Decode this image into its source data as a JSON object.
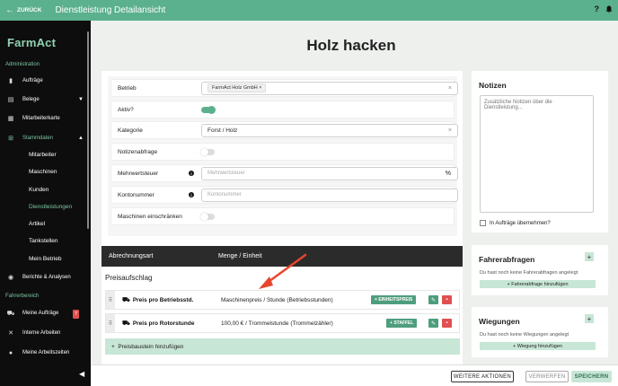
{
  "topbar": {
    "back_label": "ZURÜCK",
    "title": "Dienstleistung Detailansicht",
    "help_icon": "?",
    "icons": [
      "help-icon",
      "bell-icon"
    ]
  },
  "sidebar": {
    "logo": "FarmAct",
    "sections": {
      "admin": "Administration",
      "driver": "Fahrerbereich"
    },
    "items": [
      {
        "label": "Aufträge",
        "icon": "clipboard-icon"
      },
      {
        "label": "Belege",
        "icon": "document-icon"
      },
      {
        "label": "Mitarbeiterkarte",
        "icon": "map-icon"
      },
      {
        "label": "Stammdaten",
        "icon": "hierarchy-icon"
      }
    ],
    "subitems": [
      "Mitarbeiter",
      "Maschinen",
      "Kunden",
      "Dienstleistungen",
      "Artikel",
      "Tankstellen",
      "Mein Betrieb"
    ],
    "active_sub": "Dienstleistungen",
    "bottom_items": [
      {
        "label": "Berichte & Analysen",
        "icon": "chart-search-icon"
      },
      {
        "label": "Meine Aufträge",
        "icon": "tractor-icon",
        "badge": "7"
      },
      {
        "label": "Interne Arbeiten",
        "icon": "tools-icon"
      },
      {
        "label": "Meine Arbeitszeiten",
        "icon": "person-clock-icon"
      }
    ]
  },
  "main": {
    "heading": "Holz hacken",
    "form": {
      "betrieb": {
        "label": "Betrieb",
        "chip": "FarmAct Holz GmbH"
      },
      "aktiv": {
        "label": "Aktiv?",
        "on": true
      },
      "kategorie": {
        "label": "Kategorie",
        "value": "Forst / Holz"
      },
      "notizenabfrage": {
        "label": "Notizenabfrage",
        "on": false
      },
      "mehrwertsteuer": {
        "label": "Mehrwertsteuer",
        "placeholder": "Mehrwertsteuer",
        "suffix": "%"
      },
      "kontonummer": {
        "label": "Kontonummer",
        "placeholder": "Kontonummer"
      },
      "maschinen": {
        "label": "Maschinen einschränken",
        "on": false
      }
    },
    "table": {
      "headers": [
        "Abrechnungsart",
        "Menge / Einheit"
      ],
      "section": "Preisaufschlag",
      "rows": [
        {
          "name": "Preis pro Betriebsstd.",
          "unit": "Maschinenpreis / Stunde (Betriebsstunden)",
          "tag": "EINHEITSPREIS"
        },
        {
          "name": "Preis pro Rotorstunde",
          "unit": "100,00 € / Trommelstunde (Trommelzähler)",
          "tag": "STAFFEL"
        }
      ],
      "add_label": "Preisbaustein hinzufügen"
    }
  },
  "notes": {
    "title": "Notizen",
    "placeholder": "Zusätzliche Notizen über die Dienstleistung...",
    "checkbox_label": "In Aufträge übernehmen?"
  },
  "fahrerabfragen": {
    "title": "Fahrerabfragen",
    "empty": "Du hast noch keine Fahrerabfragen angelegt",
    "add": "Fahrerabfrage hinzufügen"
  },
  "wiegungen": {
    "title": "Wiegungen",
    "empty": "Du hast noch keine Wiegungen angelegt",
    "add": "Wiegung hinzufügen"
  },
  "footer": {
    "more": "WEITERE AKTIONEN",
    "discard": "VERWERFEN",
    "save": "SPEICHERN"
  },
  "colors": {
    "accent": "#5bb08e",
    "sidebar": "#0d0d0d",
    "danger": "#e05050",
    "annotation_arrow": "#e8452f"
  }
}
